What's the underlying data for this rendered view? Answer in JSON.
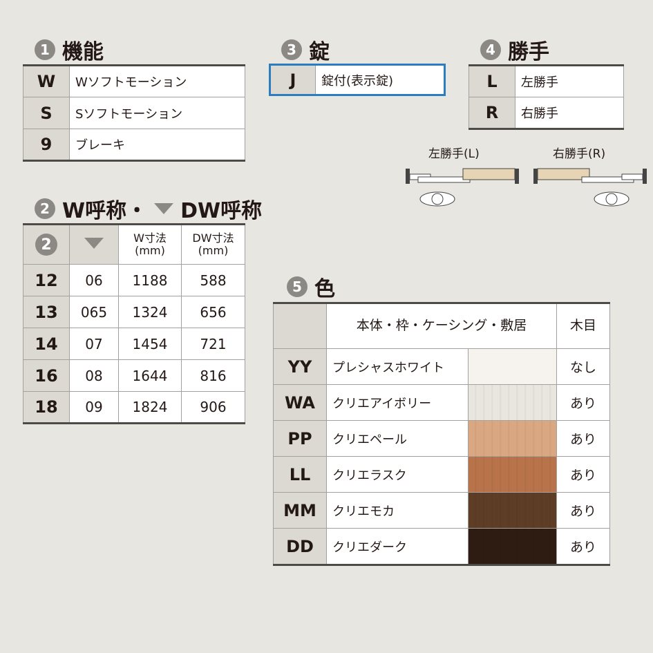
{
  "sec1": {
    "num": "1",
    "title": "機能",
    "rows": [
      {
        "code": "W",
        "label": "Wソフトモーション"
      },
      {
        "code": "S",
        "label": "Sソフトモーション"
      },
      {
        "code": "9",
        "label": "ブレーキ"
      }
    ]
  },
  "sec2": {
    "num": "2",
    "title": "W呼称・",
    "title2": "DW呼称",
    "header": {
      "col_num": "2",
      "w": "W寸法\n(mm)",
      "dw": "DW寸法\n(mm)"
    },
    "rows": [
      {
        "code": "12",
        "dw_code": "06",
        "w": "1188",
        "dw": "588"
      },
      {
        "code": "13",
        "dw_code": "065",
        "w": "1324",
        "dw": "656"
      },
      {
        "code": "14",
        "dw_code": "07",
        "w": "1454",
        "dw": "721"
      },
      {
        "code": "16",
        "dw_code": "08",
        "w": "1644",
        "dw": "816"
      },
      {
        "code": "18",
        "dw_code": "09",
        "w": "1824",
        "dw": "906"
      }
    ]
  },
  "sec3": {
    "num": "3",
    "title": "錠",
    "rows": [
      {
        "code": "J",
        "label": "錠付(表示錠)"
      }
    ]
  },
  "sec4": {
    "num": "4",
    "title": "勝手",
    "rows": [
      {
        "code": "L",
        "label": "左勝手"
      },
      {
        "code": "R",
        "label": "右勝手"
      }
    ],
    "diagram_left": "左勝手(L)",
    "diagram_right": "右勝手(R)"
  },
  "sec5": {
    "num": "5",
    "title": "色",
    "header": {
      "body": "本体・枠・ケーシング・敷居",
      "wood": "木目"
    },
    "rows": [
      {
        "code": "YY",
        "label": "プレシャスホワイト",
        "wood": "なし",
        "color": "#f6f3ee"
      },
      {
        "code": "WA",
        "label": "クリエアイボリー",
        "wood": "あり",
        "color": "#e9e6e0"
      },
      {
        "code": "PP",
        "label": "クリエペール",
        "wood": "あり",
        "color": "#d9a882"
      },
      {
        "code": "LL",
        "label": "クリエラスク",
        "wood": "あり",
        "color": "#b8734a"
      },
      {
        "code": "MM",
        "label": "クリエモカ",
        "wood": "あり",
        "color": "#5e3d26"
      },
      {
        "code": "DD",
        "label": "クリエダーク",
        "wood": "あり",
        "color": "#2e1c12"
      }
    ]
  },
  "colors": {
    "accent_border": "#2b7dc0"
  }
}
